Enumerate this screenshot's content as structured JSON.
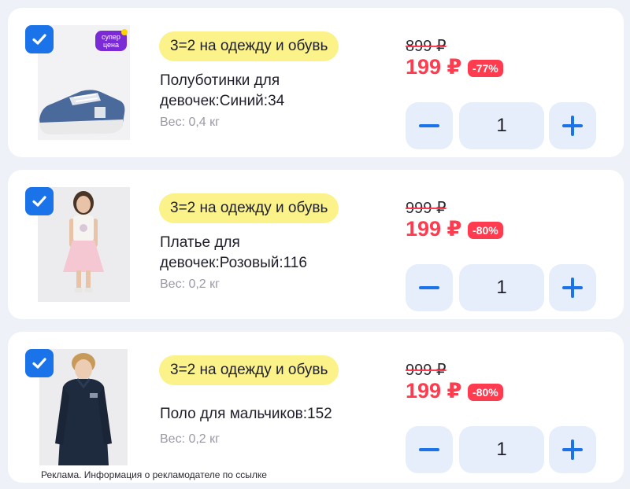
{
  "items": [
    {
      "promo": "3=2 на одежду и обувь",
      "title": "Полуботинки для девочек:Синий:34",
      "weight": "Вес: 0,4 кг",
      "old_price": "899 ₽",
      "new_price": "199 ₽",
      "discount": "-77%",
      "quantity": "1",
      "badge": "супер цена",
      "image": "blue-sneaker-image"
    },
    {
      "promo": "3=2 на одежду и обувь",
      "title": "Платье для девочек:Розовый:116",
      "weight": "Вес: 0,2 кг",
      "old_price": "999 ₽",
      "new_price": "199 ₽",
      "discount": "-80%",
      "quantity": "1",
      "image": "girl-pink-dress-image"
    },
    {
      "promo": "3=2 на одежду и обувь",
      "title": "Поло для мальчиков:152",
      "weight": "Вес: 0,2 кг",
      "old_price": "999 ₽",
      "new_price": "199 ₽",
      "discount": "-80%",
      "quantity": "1",
      "image": "boy-navy-polo-image"
    }
  ],
  "ad_note": "Реклама. Информация о рекламодателе по ссылке",
  "colors": {
    "accent_blue": "#1a73e8",
    "price_red": "#ff3b4f",
    "promo_yellow": "#fbf28a",
    "stepper_bg": "#e7eefb"
  }
}
